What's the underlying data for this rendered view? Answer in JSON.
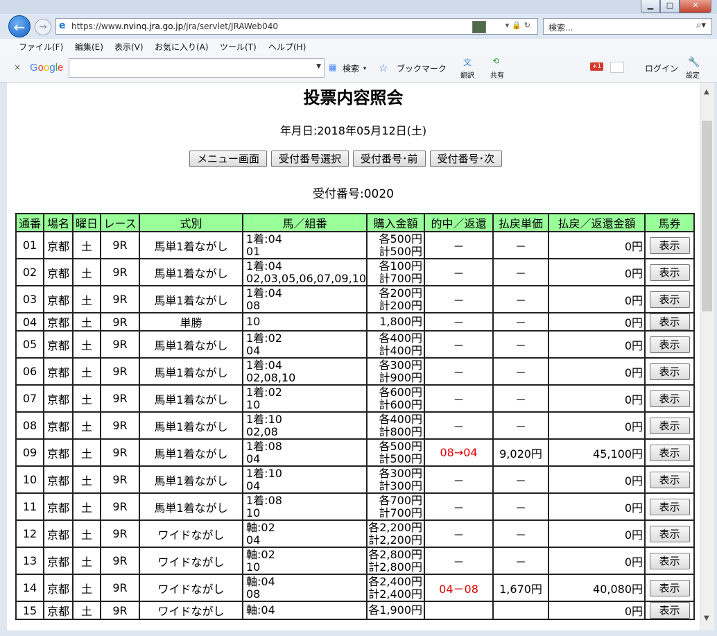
{
  "browser": {
    "url_prefix": "https://www.",
    "url_host": "nvinq.jra.go.jp",
    "url_path": "/jra/servlet/JRAWeb040",
    "search_placeholder": "検索...",
    "menu": [
      "ファイル(F)",
      "編集(E)",
      "表示(V)",
      "お気に入り(A)",
      "ツール(T)",
      "ヘルプ(H)"
    ],
    "google_bar": {
      "logo": "Google",
      "search_label": "検索",
      "bookmark_label": "ブックマーク",
      "translate_label": "翻訳",
      "share_label": "共有",
      "login_label": "ログイン",
      "settings_label": "設定",
      "gplus_label": "+1"
    }
  },
  "page": {
    "title": "投票内容照会",
    "date_line": "年月日:2018年05月12日(土)",
    "buttons": [
      "メニュー画面",
      "受付番号選択",
      "受付番号･前",
      "受付番号･次"
    ],
    "receipt_no": "受付番号:0020",
    "show_label": "表示"
  },
  "table": {
    "headers": [
      "通番",
      "場名",
      "曜日",
      "レース",
      "式別",
      "馬／組番",
      "購入金額",
      "的中／返還",
      "払戻単価",
      "払戻／返還金額",
      "馬券"
    ],
    "rows": [
      {
        "no": "01",
        "place": "京都",
        "day": "土",
        "race": "9R",
        "type": "馬単1着ながし",
        "combo1": "1着:04",
        "combo2": "01",
        "amt1": "各500円",
        "amt2": "計500円",
        "hit": "－",
        "unit": "－",
        "payout": "0円"
      },
      {
        "no": "02",
        "place": "京都",
        "day": "土",
        "race": "9R",
        "type": "馬単1着ながし",
        "combo1": "1着:04",
        "combo2": "02,03,05,06,07,09,10",
        "amt1": "各100円",
        "amt2": "計700円",
        "hit": "－",
        "unit": "－",
        "payout": "0円"
      },
      {
        "no": "03",
        "place": "京都",
        "day": "土",
        "race": "9R",
        "type": "馬単1着ながし",
        "combo1": "1着:04",
        "combo2": "08",
        "amt1": "各200円",
        "amt2": "計200円",
        "hit": "－",
        "unit": "－",
        "payout": "0円"
      },
      {
        "no": "04",
        "place": "京都",
        "day": "土",
        "race": "9R",
        "type": "単勝",
        "combo1": "10",
        "combo2": "",
        "amt1": "1,800円",
        "amt2": "",
        "hit": "－",
        "unit": "－",
        "payout": "0円"
      },
      {
        "no": "05",
        "place": "京都",
        "day": "土",
        "race": "9R",
        "type": "馬単1着ながし",
        "combo1": "1着:02",
        "combo2": "04",
        "amt1": "各400円",
        "amt2": "計400円",
        "hit": "－",
        "unit": "－",
        "payout": "0円"
      },
      {
        "no": "06",
        "place": "京都",
        "day": "土",
        "race": "9R",
        "type": "馬単1着ながし",
        "combo1": "1着:04",
        "combo2": "02,08,10",
        "amt1": "各300円",
        "amt2": "計900円",
        "hit": "－",
        "unit": "－",
        "payout": "0円"
      },
      {
        "no": "07",
        "place": "京都",
        "day": "土",
        "race": "9R",
        "type": "馬単1着ながし",
        "combo1": "1着:02",
        "combo2": "10",
        "amt1": "各600円",
        "amt2": "計600円",
        "hit": "－",
        "unit": "－",
        "payout": "0円"
      },
      {
        "no": "08",
        "place": "京都",
        "day": "土",
        "race": "9R",
        "type": "馬単1着ながし",
        "combo1": "1着:10",
        "combo2": "02,08",
        "amt1": "各400円",
        "amt2": "計800円",
        "hit": "－",
        "unit": "－",
        "payout": "0円"
      },
      {
        "no": "09",
        "place": "京都",
        "day": "土",
        "race": "9R",
        "type": "馬単1着ながし",
        "combo1": "1着:08",
        "combo2": "04",
        "amt1": "各500円",
        "amt2": "計500円",
        "hit": "08→04",
        "unit": "9,020円",
        "payout": "45,100円",
        "win": true
      },
      {
        "no": "10",
        "place": "京都",
        "day": "土",
        "race": "9R",
        "type": "馬単1着ながし",
        "combo1": "1着:10",
        "combo2": "04",
        "amt1": "各300円",
        "amt2": "計300円",
        "hit": "－",
        "unit": "－",
        "payout": "0円"
      },
      {
        "no": "11",
        "place": "京都",
        "day": "土",
        "race": "9R",
        "type": "馬単1着ながし",
        "combo1": "1着:08",
        "combo2": "10",
        "amt1": "各700円",
        "amt2": "計700円",
        "hit": "－",
        "unit": "－",
        "payout": "0円"
      },
      {
        "no": "12",
        "place": "京都",
        "day": "土",
        "race": "9R",
        "type": "ワイドながし",
        "combo1": "軸:02",
        "combo2": "04",
        "amt1": "各2,200円",
        "amt2": "計2,200円",
        "hit": "－",
        "unit": "－",
        "payout": "0円"
      },
      {
        "no": "13",
        "place": "京都",
        "day": "土",
        "race": "9R",
        "type": "ワイドながし",
        "combo1": "軸:02",
        "combo2": "10",
        "amt1": "各2,800円",
        "amt2": "計2,800円",
        "hit": "－",
        "unit": "－",
        "payout": "0円"
      },
      {
        "no": "14",
        "place": "京都",
        "day": "土",
        "race": "9R",
        "type": "ワイドながし",
        "combo1": "軸:04",
        "combo2": "08",
        "amt1": "各2,400円",
        "amt2": "計2,400円",
        "hit": "04－08",
        "unit": "1,670円",
        "payout": "40,080円",
        "win": true
      },
      {
        "no": "15",
        "place": "京都",
        "day": "土",
        "race": "9R",
        "type": "ワイドながし",
        "combo1": "軸:04",
        "combo2": "",
        "amt1": "各1,900円",
        "amt2": "",
        "hit": "",
        "unit": "",
        "payout": "0円"
      }
    ]
  },
  "colors": {
    "header_bg": "#99ff99",
    "hit_text": "#e00000"
  }
}
